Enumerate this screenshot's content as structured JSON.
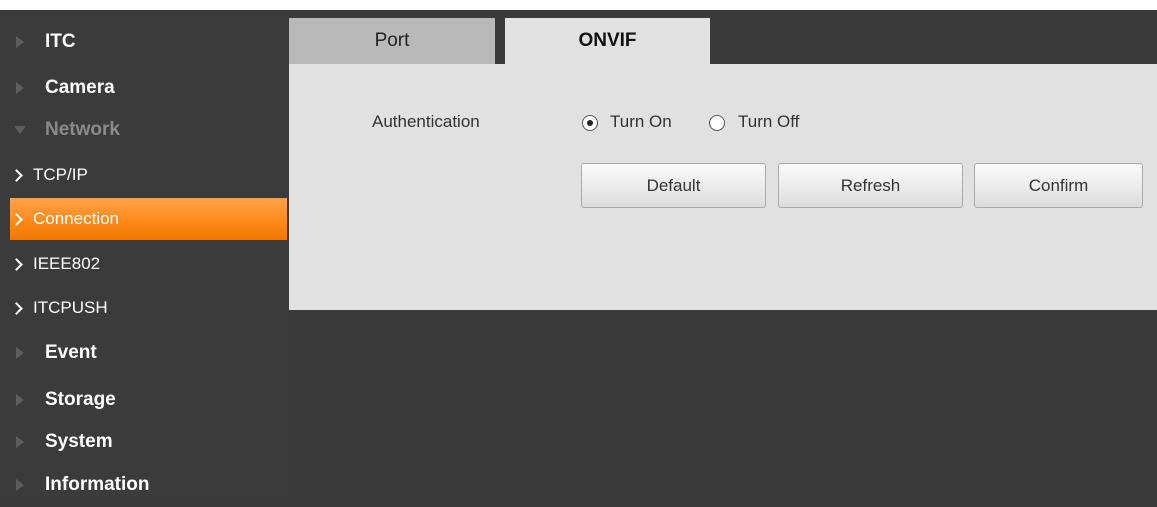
{
  "sidebar": {
    "items": [
      {
        "label": "ITC"
      },
      {
        "label": "Camera"
      },
      {
        "label": "Network"
      },
      {
        "label": "Event"
      },
      {
        "label": "Storage"
      },
      {
        "label": "System"
      },
      {
        "label": "Information"
      }
    ],
    "network_children": [
      {
        "label": "TCP/IP"
      },
      {
        "label": "Connection"
      },
      {
        "label": "IEEE802"
      },
      {
        "label": "ITCPUSH"
      }
    ],
    "active_child": "Connection"
  },
  "tabs": [
    {
      "label": "Port"
    },
    {
      "label": "ONVIF"
    }
  ],
  "active_tab": "ONVIF",
  "onvif": {
    "auth_label": "Authentication",
    "options": [
      {
        "label": "Turn On",
        "selected": true
      },
      {
        "label": "Turn Off",
        "selected": false
      }
    ],
    "buttons": {
      "default_label": "Default",
      "refresh_label": "Refresh",
      "confirm_label": "Confirm"
    }
  },
  "colors": {
    "sidebar_bg": "#3b3b3b",
    "active_item": "#ff8a1a",
    "panel_bg": "#e1e1e1",
    "inactive_tab": "#b9b9b9"
  }
}
